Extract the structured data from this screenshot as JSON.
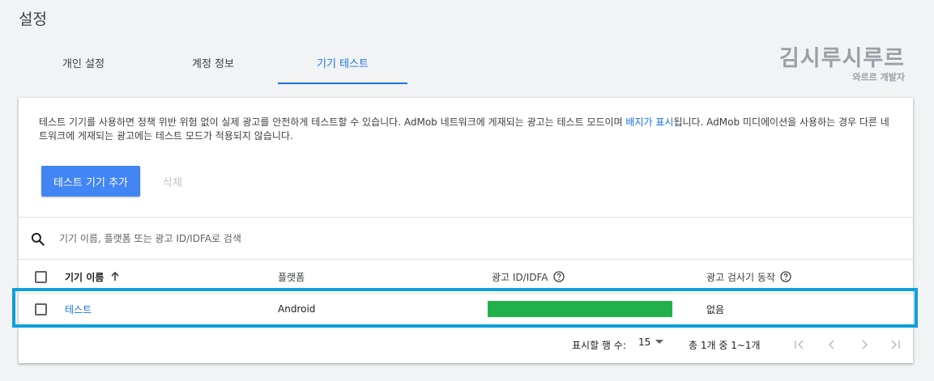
{
  "page": {
    "title": "설정"
  },
  "tabs": [
    {
      "label": "개인 설정",
      "active": false
    },
    {
      "label": "계정 정보",
      "active": false
    },
    {
      "label": "기기 테스트",
      "active": true
    }
  ],
  "watermark": {
    "title": "김시루시루르",
    "subtitle": "와르르 개발자"
  },
  "description": {
    "part1": "테스트 기기를 사용하면 정책 위반 위험 없이 실제 광고를 안전하게 테스트할 수 있습니다. AdMob 네트워크에 게재되는 광고는 테스트 모드이며 ",
    "link": "배지가 표시",
    "part2": "됩니다. AdMob 미디에이션을 사용하는 경우 다른 네트워크에 게재되는 광고에는 테스트 모드가 적용되지 않습니다."
  },
  "actions": {
    "add_label": "테스트 기기 추가",
    "delete_label": "삭제"
  },
  "search": {
    "placeholder": "기기 이름, 플랫폼 또는 광고 ID/IDFA로 검색"
  },
  "table": {
    "headers": {
      "name": "기기 이름",
      "platform": "플랫폼",
      "ad_id": "광고 ID/IDFA",
      "inspector": "광고 검사기 동작"
    },
    "rows": [
      {
        "name": "테스트",
        "platform": "Android",
        "inspector": "없음"
      }
    ]
  },
  "pagination": {
    "rows_label": "표시할 행 수:",
    "rows_value": "15",
    "range": "총 1개 중 1~1개"
  },
  "colors": {
    "accent": "#1a73e8",
    "button": "#4285f4",
    "id_mask": "#22b04b",
    "highlight": "#0da0dc"
  },
  "icons": [
    "search-icon",
    "sort-arrow-up-icon",
    "help-circle-icon",
    "dropdown-arrow-icon",
    "first-page-icon",
    "prev-page-icon",
    "next-page-icon",
    "last-page-icon"
  ]
}
